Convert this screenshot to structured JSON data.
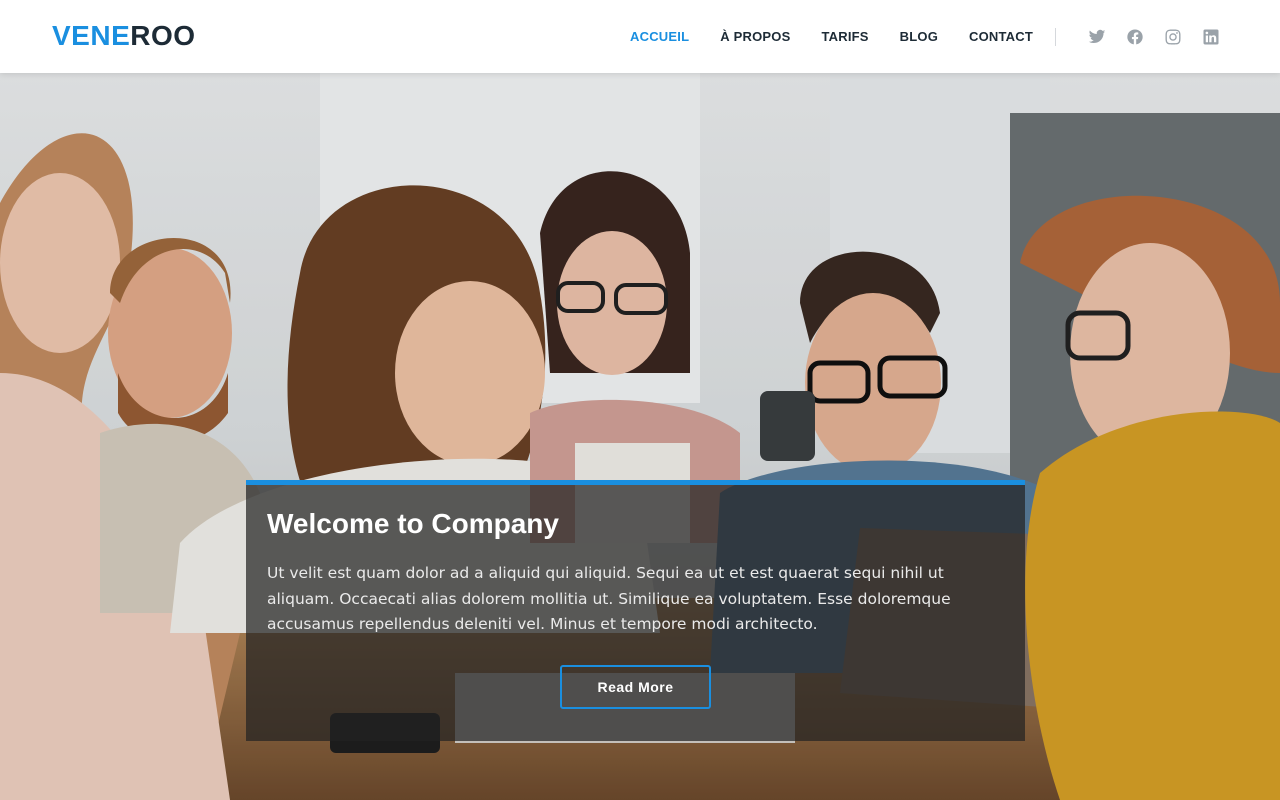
{
  "brand": {
    "logo_part1": "VENE",
    "logo_part2": "ROO",
    "accent_color": "#1a8fe0",
    "dark_color": "#1d2b36"
  },
  "nav": {
    "items": [
      {
        "label": "ACCUEIL",
        "active": true
      },
      {
        "label": "À PROPOS",
        "active": false
      },
      {
        "label": "TARIFS",
        "active": false
      },
      {
        "label": "BLOG",
        "active": false
      },
      {
        "label": "CONTACT",
        "active": false
      }
    ],
    "social": [
      "twitter-icon",
      "facebook-icon",
      "instagram-icon",
      "linkedin-icon"
    ]
  },
  "hero": {
    "image_description": "group-of-people-at-table",
    "title": "Welcome to Company",
    "text": "Ut velit est quam dolor ad a aliquid qui aliquid. Sequi ea ut et est quaerat sequi nihil ut aliquam. Occaecati alias dolorem mollitia ut. Similique ea voluptatem. Esse doloremque accusamus repellendus deleniti vel. Minus et tempore modi architecto.",
    "button_label": "Read More"
  }
}
